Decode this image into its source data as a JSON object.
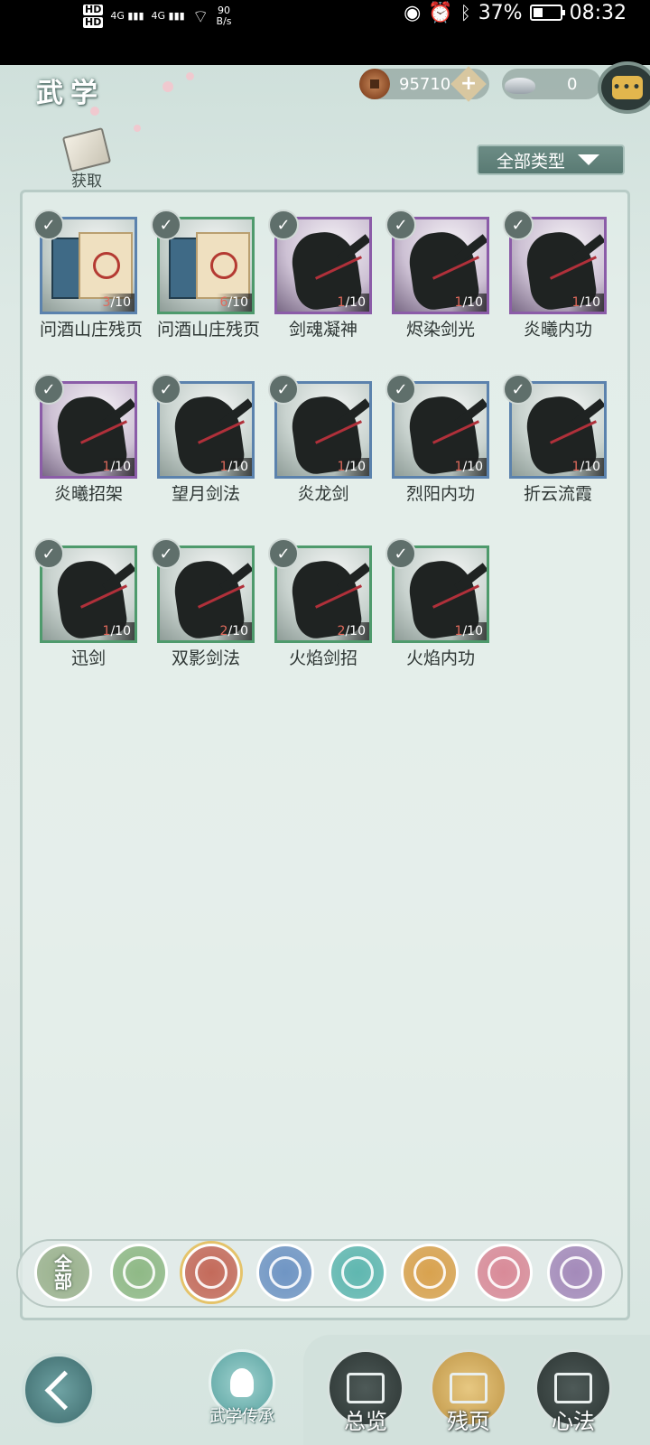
{
  "status_bar": {
    "hd1": "HD",
    "hd2": "HD",
    "net1": "4G",
    "net2": "4G",
    "speed_value": "90",
    "speed_unit": "B/s",
    "battery_percent": "37%",
    "battery_level": 0.37,
    "time": "08:32",
    "icons": [
      "eye-icon",
      "alarm-icon",
      "bluetooth-icon",
      "battery-icon",
      "wifi-icon",
      "signal-icon"
    ]
  },
  "header": {
    "title": "武学",
    "coins": "95710",
    "silver": "0",
    "chat_icon_text": "•••"
  },
  "obtain": {
    "label": "获取"
  },
  "filter": {
    "label": "全部类型"
  },
  "skills": [
    {
      "name": "问酒山庄残页",
      "count_current": "3",
      "count_total": "/10",
      "frame": "blue",
      "art": "book"
    },
    {
      "name": "问酒山庄残页",
      "count_current": "6",
      "count_total": "/10",
      "frame": "green",
      "art": "book"
    },
    {
      "name": "剑魂凝神",
      "count_current": "1",
      "count_total": "/10",
      "frame": "purple",
      "art": "fighter"
    },
    {
      "name": "烬染剑光",
      "count_current": "1",
      "count_total": "/10",
      "frame": "purple",
      "art": "fighter"
    },
    {
      "name": "炎曦内功",
      "count_current": "1",
      "count_total": "/10",
      "frame": "purple",
      "art": "fighter"
    },
    {
      "name": "炎曦招架",
      "count_current": "1",
      "count_total": "/10",
      "frame": "purple",
      "art": "fighter"
    },
    {
      "name": "望月剑法",
      "count_current": "1",
      "count_total": "/10",
      "frame": "blue",
      "art": "fighter"
    },
    {
      "name": "炎龙剑",
      "count_current": "1",
      "count_total": "/10",
      "frame": "blue",
      "art": "fighter"
    },
    {
      "name": "烈阳内功",
      "count_current": "1",
      "count_total": "/10",
      "frame": "blue",
      "art": "fighter"
    },
    {
      "name": "折云流霞",
      "count_current": "1",
      "count_total": "/10",
      "frame": "blue",
      "art": "fighter"
    },
    {
      "name": "迅剑",
      "count_current": "1",
      "count_total": "/10",
      "frame": "green",
      "art": "fighter"
    },
    {
      "name": "双影剑法",
      "count_current": "2",
      "count_total": "/10",
      "frame": "green",
      "art": "fighter"
    },
    {
      "name": "火焰剑招",
      "count_current": "2",
      "count_total": "/10",
      "frame": "green",
      "art": "fighter"
    },
    {
      "name": "火焰内功",
      "count_current": "1",
      "count_total": "/10",
      "frame": "green",
      "art": "fighter"
    }
  ],
  "categories": [
    {
      "id": "all",
      "label_top": "全",
      "label_bottom": "部",
      "color": "#9bb28e",
      "icon": "all-icon"
    },
    {
      "id": "c1",
      "color": "#8fb986",
      "icon": "bamboo-sword-icon"
    },
    {
      "id": "c2",
      "color": "#c46a5a",
      "icon": "flame-icon",
      "selected": true
    },
    {
      "id": "c3",
      "color": "#6f95c4",
      "icon": "wave-icon"
    },
    {
      "id": "c4",
      "color": "#5fb7b0",
      "icon": "butterfly-icon"
    },
    {
      "id": "c5",
      "color": "#d9a24e",
      "icon": "shield-icon"
    },
    {
      "id": "c6",
      "color": "#d98a98",
      "icon": "crescent-icon"
    },
    {
      "id": "c7",
      "color": "#a48aba",
      "icon": "rose-icon"
    }
  ],
  "bottom_nav": {
    "inherit_label": "武学传承",
    "tabs": [
      {
        "label": "总览",
        "icon": "open-book-icon"
      },
      {
        "label": "残页",
        "icon": "puzzle-icon",
        "selected": true
      },
      {
        "label": "心法",
        "icon": "spirit-flame-icon"
      }
    ]
  }
}
